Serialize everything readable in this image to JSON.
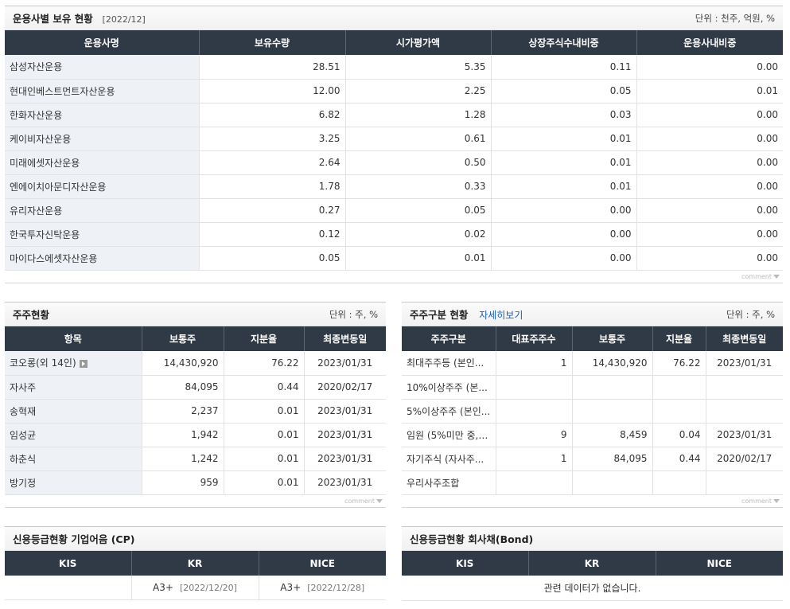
{
  "fund_holdings": {
    "title": "운용사별 보유 현황",
    "date": "[2022/12]",
    "unit": "단위 : 천주, 억원, %",
    "columns": [
      "운용사명",
      "보유수량",
      "시가평가액",
      "상장주식수내비중",
      "운용사내비중"
    ],
    "rows": [
      {
        "name": "삼성자산운용",
        "qty": "28.51",
        "value": "5.35",
        "listed_ratio": "0.11",
        "fund_ratio": "0.00"
      },
      {
        "name": "현대인베스트먼트자산운용",
        "qty": "12.00",
        "value": "2.25",
        "listed_ratio": "0.05",
        "fund_ratio": "0.01"
      },
      {
        "name": "한화자산운용",
        "qty": "6.82",
        "value": "1.28",
        "listed_ratio": "0.03",
        "fund_ratio": "0.00"
      },
      {
        "name": "케이비자산운용",
        "qty": "3.25",
        "value": "0.61",
        "listed_ratio": "0.01",
        "fund_ratio": "0.00"
      },
      {
        "name": "미래에셋자산운용",
        "qty": "2.64",
        "value": "0.50",
        "listed_ratio": "0.01",
        "fund_ratio": "0.00"
      },
      {
        "name": "엔에이치아문디자산운용",
        "qty": "1.78",
        "value": "0.33",
        "listed_ratio": "0.01",
        "fund_ratio": "0.00"
      },
      {
        "name": "유리자산운용",
        "qty": "0.27",
        "value": "0.05",
        "listed_ratio": "0.00",
        "fund_ratio": "0.00"
      },
      {
        "name": "한국투자신탁운용",
        "qty": "0.12",
        "value": "0.02",
        "listed_ratio": "0.00",
        "fund_ratio": "0.00"
      },
      {
        "name": "마이다스에셋자산운용",
        "qty": "0.05",
        "value": "0.01",
        "listed_ratio": "0.00",
        "fund_ratio": "0.00"
      }
    ],
    "footer": "comment"
  },
  "shareholders": {
    "title": "주주현황",
    "unit": "단위 : 주, %",
    "columns": [
      "항목",
      "보통주",
      "지분율",
      "최종변동일"
    ],
    "rows": [
      {
        "name": "코오롱(외 14인)",
        "shares": "14,430,920",
        "ratio": "76.22",
        "date": "2023/01/31"
      },
      {
        "name": "자사주",
        "shares": "84,095",
        "ratio": "0.44",
        "date": "2020/02/17"
      },
      {
        "name": "송혁재",
        "shares": "2,237",
        "ratio": "0.01",
        "date": "2023/01/31"
      },
      {
        "name": "임성균",
        "shares": "1,942",
        "ratio": "0.01",
        "date": "2023/01/31"
      },
      {
        "name": "하춘식",
        "shares": "1,242",
        "ratio": "0.01",
        "date": "2023/01/31"
      },
      {
        "name": "방기정",
        "shares": "959",
        "ratio": "0.01",
        "date": "2023/01/31"
      }
    ],
    "footer": "comment"
  },
  "shareholder_types": {
    "title": "주주구분 현황",
    "more_label": "자세히보기",
    "unit": "단위 : 주, %",
    "columns": [
      "주주구분",
      "대표주주수",
      "보통주",
      "지분율",
      "최종변동일"
    ],
    "rows": [
      {
        "name": "최대주주등 (본인...",
        "count": "1",
        "shares": "14,430,920",
        "ratio": "76.22",
        "date": "2023/01/31"
      },
      {
        "name": "10%이상주주 (본...",
        "count": "",
        "shares": "",
        "ratio": "",
        "date": ""
      },
      {
        "name": "5%이상주주 (본인...",
        "count": "",
        "shares": "",
        "ratio": "",
        "date": ""
      },
      {
        "name": "임원 (5%미만 중, ...",
        "count": "9",
        "shares": "8,459",
        "ratio": "0.04",
        "date": "2023/01/31"
      },
      {
        "name": "자기주식 (자사주...",
        "count": "1",
        "shares": "84,095",
        "ratio": "0.44",
        "date": "2020/02/17"
      },
      {
        "name": "우리사주조합",
        "count": "",
        "shares": "",
        "ratio": "",
        "date": ""
      }
    ],
    "footer": "comment"
  },
  "credit_cp": {
    "title": "신용등급현황 기업어음 (CP)",
    "columns": [
      "KIS",
      "KR",
      "NICE"
    ],
    "kis": {
      "grade": "",
      "date": ""
    },
    "kr": {
      "grade": "A3+",
      "date": "[2022/12/20]"
    },
    "nice": {
      "grade": "A3+",
      "date": "[2022/12/28]"
    }
  },
  "credit_bond": {
    "title": "신용등급현황 회사채(Bond)",
    "columns": [
      "KIS",
      "KR",
      "NICE"
    ],
    "empty_message": "관련 데이터가 없습니다."
  }
}
